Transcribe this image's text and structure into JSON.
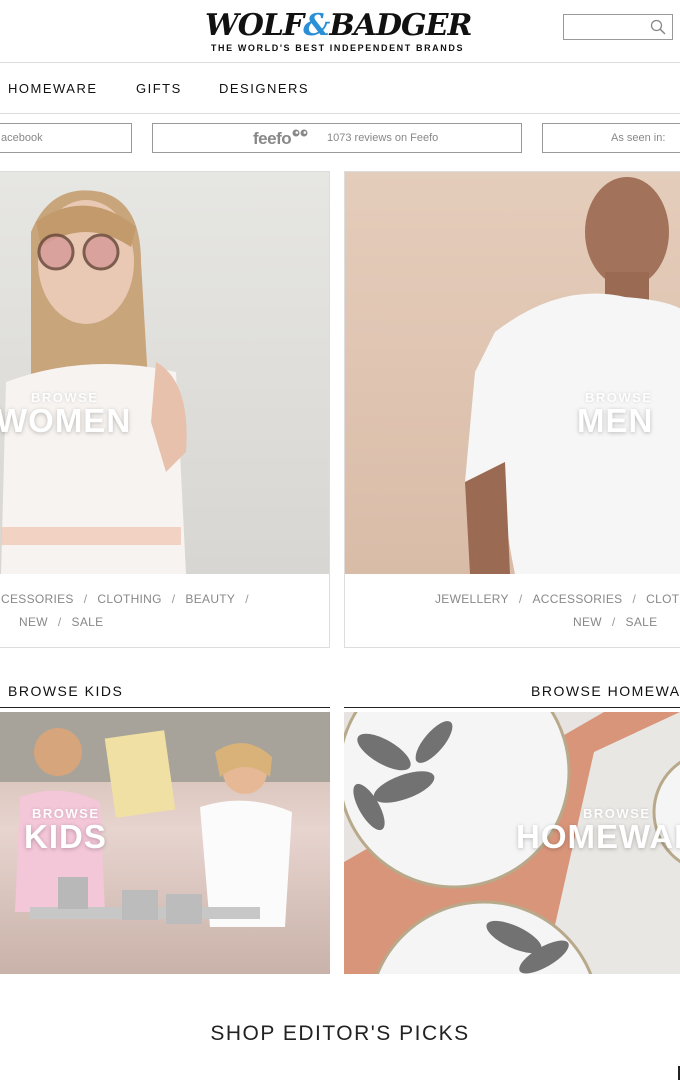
{
  "header": {
    "logo_main_left": "WOLF",
    "logo_amp": "&",
    "logo_main_right": "BADGER",
    "logo_tagline": "THE WORLD'S BEST INDEPENDENT BRANDS",
    "search_placeholder": ""
  },
  "nav": {
    "items": [
      "HOMEWARE",
      "GIFTS",
      "DESIGNERS"
    ]
  },
  "trust_bar": {
    "facebook_label": "acebook",
    "feefo_logo": "feefo",
    "feefo_reviews": "1073 reviews on Feefo",
    "seen_in_label": "As seen in:"
  },
  "categories": {
    "women": {
      "browse": "BROWSE",
      "title": "WOMEN",
      "links_row1": [
        "CESSORIES",
        "CLOTHING",
        "BEAUTY"
      ],
      "links_row2": [
        "NEW",
        "SALE"
      ]
    },
    "men": {
      "browse": "BROWSE",
      "title": "MEN",
      "links_row1": [
        "JEWELLERY",
        "ACCESSORIES",
        "CLOTHING"
      ],
      "links_row2": [
        "NEW",
        "SALE"
      ]
    }
  },
  "sections": {
    "kids": {
      "heading": "BROWSE KIDS",
      "browse": "BROWSE",
      "title": "KIDS"
    },
    "homeware": {
      "heading": "BROWSE HOMEWARE",
      "browse": "BROWSE",
      "title": "HOMEWARE"
    }
  },
  "editors_picks": "SHOP EDITOR'S PICKS",
  "colors": {
    "accent_blue": "#2a8fd6",
    "text_dark": "#111111",
    "text_muted": "#888888",
    "border": "#999999"
  },
  "icons": {
    "search": "search-icon"
  }
}
